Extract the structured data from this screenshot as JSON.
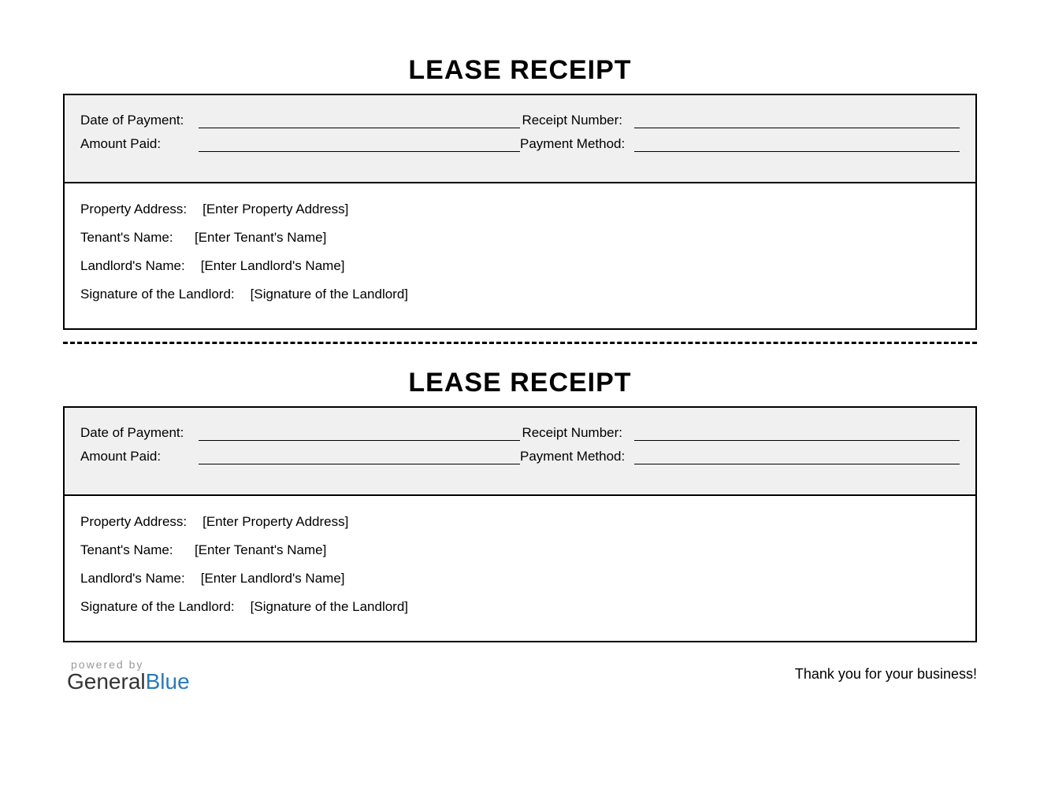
{
  "title": "LEASE RECEIPT",
  "top": {
    "date_label": "Date of Payment:",
    "receipt_num_label": "Receipt Number:",
    "amount_label": "Amount Paid:",
    "method_label": "Payment Method:"
  },
  "bottom": {
    "property_label": "Property Address:",
    "property_value": "[Enter Property Address]",
    "tenant_label": "Tenant's Name:",
    "tenant_value": "[Enter Tenant's Name]",
    "landlord_label": "Landlord's Name:",
    "landlord_value": "[Enter Landlord's Name]",
    "signature_label": "Signature of the Landlord:",
    "signature_value": "[Signature of the Landlord]"
  },
  "footer": {
    "powered_by": "powered by",
    "brand_one": "General",
    "brand_two": "Blue",
    "thanks": "Thank you for your business!"
  }
}
